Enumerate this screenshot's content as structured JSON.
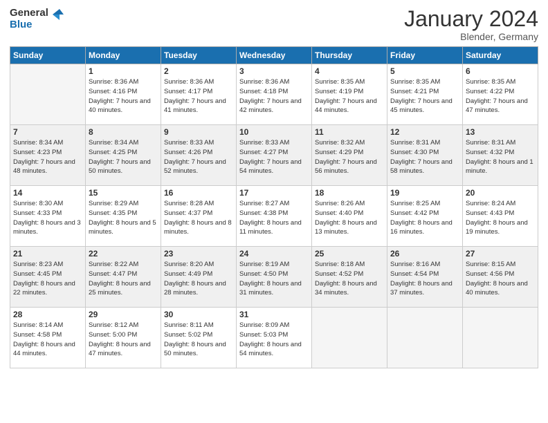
{
  "header": {
    "logo_line1": "General",
    "logo_line2": "Blue",
    "month": "January 2024",
    "location": "Blender, Germany"
  },
  "weekdays": [
    "Sunday",
    "Monday",
    "Tuesday",
    "Wednesday",
    "Thursday",
    "Friday",
    "Saturday"
  ],
  "weeks": [
    [
      {
        "day": "",
        "empty": true
      },
      {
        "day": "1",
        "sunrise": "Sunrise: 8:36 AM",
        "sunset": "Sunset: 4:16 PM",
        "daylight": "Daylight: 7 hours and 40 minutes."
      },
      {
        "day": "2",
        "sunrise": "Sunrise: 8:36 AM",
        "sunset": "Sunset: 4:17 PM",
        "daylight": "Daylight: 7 hours and 41 minutes."
      },
      {
        "day": "3",
        "sunrise": "Sunrise: 8:36 AM",
        "sunset": "Sunset: 4:18 PM",
        "daylight": "Daylight: 7 hours and 42 minutes."
      },
      {
        "day": "4",
        "sunrise": "Sunrise: 8:35 AM",
        "sunset": "Sunset: 4:19 PM",
        "daylight": "Daylight: 7 hours and 44 minutes."
      },
      {
        "day": "5",
        "sunrise": "Sunrise: 8:35 AM",
        "sunset": "Sunset: 4:21 PM",
        "daylight": "Daylight: 7 hours and 45 minutes."
      },
      {
        "day": "6",
        "sunrise": "Sunrise: 8:35 AM",
        "sunset": "Sunset: 4:22 PM",
        "daylight": "Daylight: 7 hours and 47 minutes."
      }
    ],
    [
      {
        "day": "7",
        "sunrise": "Sunrise: 8:34 AM",
        "sunset": "Sunset: 4:23 PM",
        "daylight": "Daylight: 7 hours and 48 minutes."
      },
      {
        "day": "8",
        "sunrise": "Sunrise: 8:34 AM",
        "sunset": "Sunset: 4:25 PM",
        "daylight": "Daylight: 7 hours and 50 minutes."
      },
      {
        "day": "9",
        "sunrise": "Sunrise: 8:33 AM",
        "sunset": "Sunset: 4:26 PM",
        "daylight": "Daylight: 7 hours and 52 minutes."
      },
      {
        "day": "10",
        "sunrise": "Sunrise: 8:33 AM",
        "sunset": "Sunset: 4:27 PM",
        "daylight": "Daylight: 7 hours and 54 minutes."
      },
      {
        "day": "11",
        "sunrise": "Sunrise: 8:32 AM",
        "sunset": "Sunset: 4:29 PM",
        "daylight": "Daylight: 7 hours and 56 minutes."
      },
      {
        "day": "12",
        "sunrise": "Sunrise: 8:31 AM",
        "sunset": "Sunset: 4:30 PM",
        "daylight": "Daylight: 7 hours and 58 minutes."
      },
      {
        "day": "13",
        "sunrise": "Sunrise: 8:31 AM",
        "sunset": "Sunset: 4:32 PM",
        "daylight": "Daylight: 8 hours and 1 minute."
      }
    ],
    [
      {
        "day": "14",
        "sunrise": "Sunrise: 8:30 AM",
        "sunset": "Sunset: 4:33 PM",
        "daylight": "Daylight: 8 hours and 3 minutes."
      },
      {
        "day": "15",
        "sunrise": "Sunrise: 8:29 AM",
        "sunset": "Sunset: 4:35 PM",
        "daylight": "Daylight: 8 hours and 5 minutes."
      },
      {
        "day": "16",
        "sunrise": "Sunrise: 8:28 AM",
        "sunset": "Sunset: 4:37 PM",
        "daylight": "Daylight: 8 hours and 8 minutes."
      },
      {
        "day": "17",
        "sunrise": "Sunrise: 8:27 AM",
        "sunset": "Sunset: 4:38 PM",
        "daylight": "Daylight: 8 hours and 11 minutes."
      },
      {
        "day": "18",
        "sunrise": "Sunrise: 8:26 AM",
        "sunset": "Sunset: 4:40 PM",
        "daylight": "Daylight: 8 hours and 13 minutes."
      },
      {
        "day": "19",
        "sunrise": "Sunrise: 8:25 AM",
        "sunset": "Sunset: 4:42 PM",
        "daylight": "Daylight: 8 hours and 16 minutes."
      },
      {
        "day": "20",
        "sunrise": "Sunrise: 8:24 AM",
        "sunset": "Sunset: 4:43 PM",
        "daylight": "Daylight: 8 hours and 19 minutes."
      }
    ],
    [
      {
        "day": "21",
        "sunrise": "Sunrise: 8:23 AM",
        "sunset": "Sunset: 4:45 PM",
        "daylight": "Daylight: 8 hours and 22 minutes."
      },
      {
        "day": "22",
        "sunrise": "Sunrise: 8:22 AM",
        "sunset": "Sunset: 4:47 PM",
        "daylight": "Daylight: 8 hours and 25 minutes."
      },
      {
        "day": "23",
        "sunrise": "Sunrise: 8:20 AM",
        "sunset": "Sunset: 4:49 PM",
        "daylight": "Daylight: 8 hours and 28 minutes."
      },
      {
        "day": "24",
        "sunrise": "Sunrise: 8:19 AM",
        "sunset": "Sunset: 4:50 PM",
        "daylight": "Daylight: 8 hours and 31 minutes."
      },
      {
        "day": "25",
        "sunrise": "Sunrise: 8:18 AM",
        "sunset": "Sunset: 4:52 PM",
        "daylight": "Daylight: 8 hours and 34 minutes."
      },
      {
        "day": "26",
        "sunrise": "Sunrise: 8:16 AM",
        "sunset": "Sunset: 4:54 PM",
        "daylight": "Daylight: 8 hours and 37 minutes."
      },
      {
        "day": "27",
        "sunrise": "Sunrise: 8:15 AM",
        "sunset": "Sunset: 4:56 PM",
        "daylight": "Daylight: 8 hours and 40 minutes."
      }
    ],
    [
      {
        "day": "28",
        "sunrise": "Sunrise: 8:14 AM",
        "sunset": "Sunset: 4:58 PM",
        "daylight": "Daylight: 8 hours and 44 minutes."
      },
      {
        "day": "29",
        "sunrise": "Sunrise: 8:12 AM",
        "sunset": "Sunset: 5:00 PM",
        "daylight": "Daylight: 8 hours and 47 minutes."
      },
      {
        "day": "30",
        "sunrise": "Sunrise: 8:11 AM",
        "sunset": "Sunset: 5:02 PM",
        "daylight": "Daylight: 8 hours and 50 minutes."
      },
      {
        "day": "31",
        "sunrise": "Sunrise: 8:09 AM",
        "sunset": "Sunset: 5:03 PM",
        "daylight": "Daylight: 8 hours and 54 minutes."
      },
      {
        "day": "",
        "empty": true
      },
      {
        "day": "",
        "empty": true
      },
      {
        "day": "",
        "empty": true
      }
    ]
  ]
}
